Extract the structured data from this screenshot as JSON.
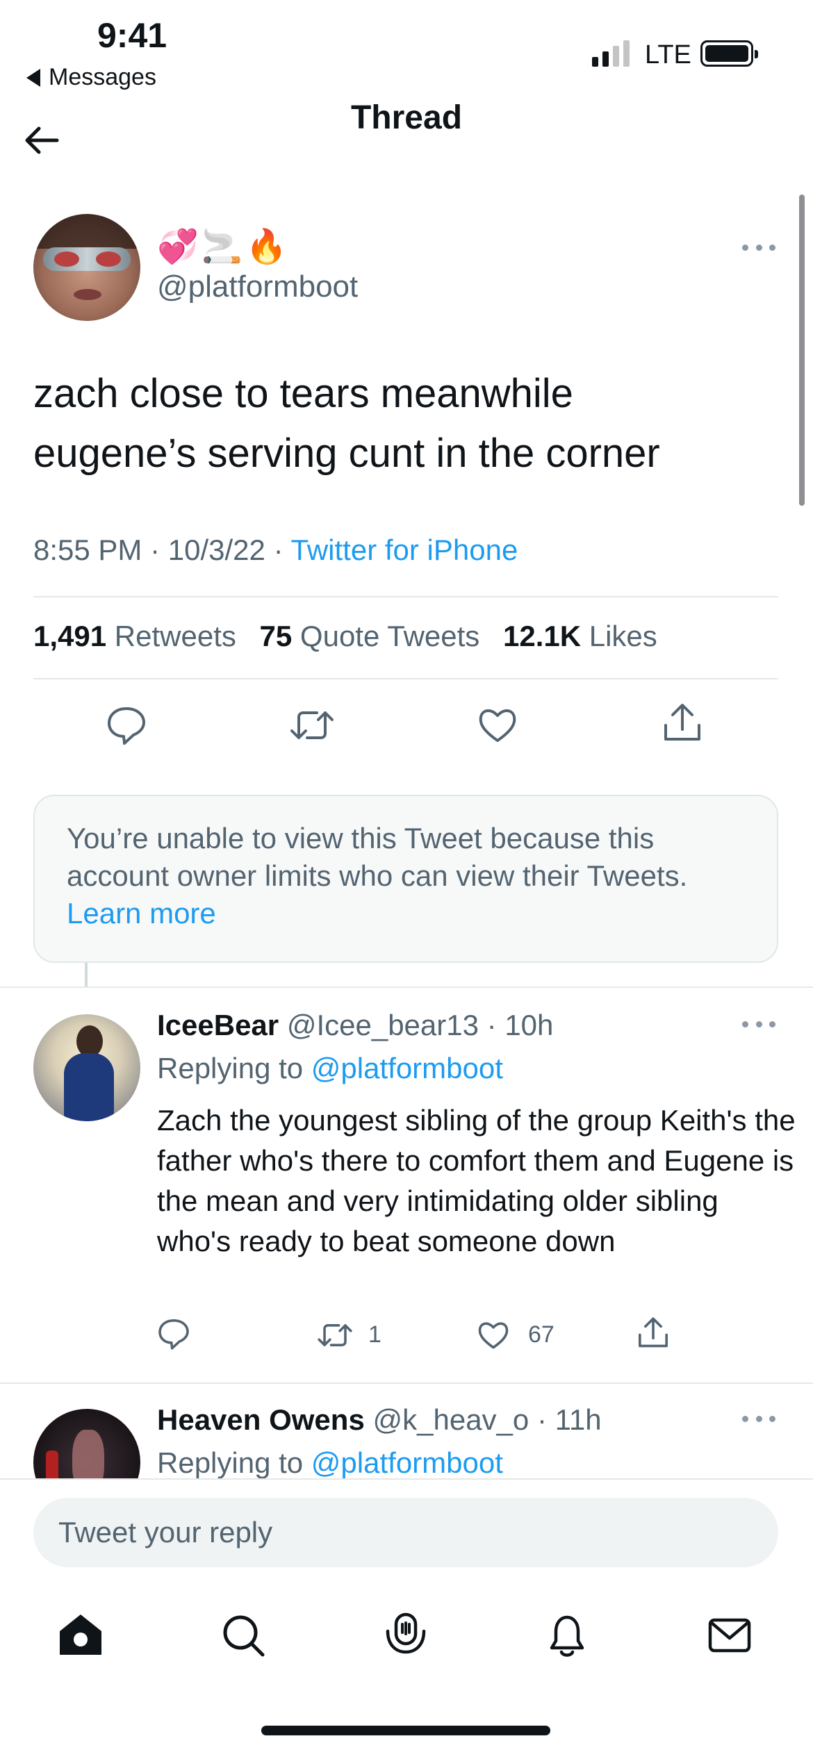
{
  "status_bar": {
    "time": "9:41",
    "back_app": "Messages",
    "network": "LTE"
  },
  "header": {
    "title": "Thread"
  },
  "main_tweet": {
    "display_name": "💞🚬🔥",
    "handle": "@platformboot",
    "text_line1": "zach close to tears meanwhile",
    "text_line2": "eugene’s serving cunt in the corner",
    "time": "8:55 PM",
    "date": "10/3/22",
    "source": "Twitter for iPhone",
    "separator": "·",
    "retweets_count": "1,491",
    "retweets_label": "Retweets",
    "quotes_count": "75",
    "quotes_label": "Quote Tweets",
    "likes_count": "12.1K",
    "likes_label": "Likes"
  },
  "limited_notice": {
    "text": "You’re unable to view this Tweet because this account owner limits who can view their Tweets.",
    "link": "Learn more"
  },
  "replies": [
    {
      "name": "IceeBear",
      "handle": "@Icee_bear13",
      "time": "10h",
      "replying_prefix": "Replying to",
      "replying_to": "@platformboot",
      "text": "Zach the youngest sibling of the group Keith's the father who's there to comfort them and Eugene is the mean and very intimidating older sibling who's ready to beat someone down",
      "retweets": "1",
      "likes": "67"
    },
    {
      "name": "Heaven Owens",
      "handle": "@k_heav_o",
      "time": "11h",
      "replying_prefix": "Replying to",
      "replying_to": "@platformboot"
    }
  ],
  "reply_input": {
    "placeholder": "Tweet your reply"
  },
  "tab_bar": [
    "home-icon",
    "search-icon",
    "spaces-icon",
    "notifications-icon",
    "messages-icon"
  ],
  "colors": {
    "accent": "#1d9bf0",
    "secondary_text": "#536471",
    "primary_text": "#0f1419",
    "divider": "#e7e7e8"
  }
}
